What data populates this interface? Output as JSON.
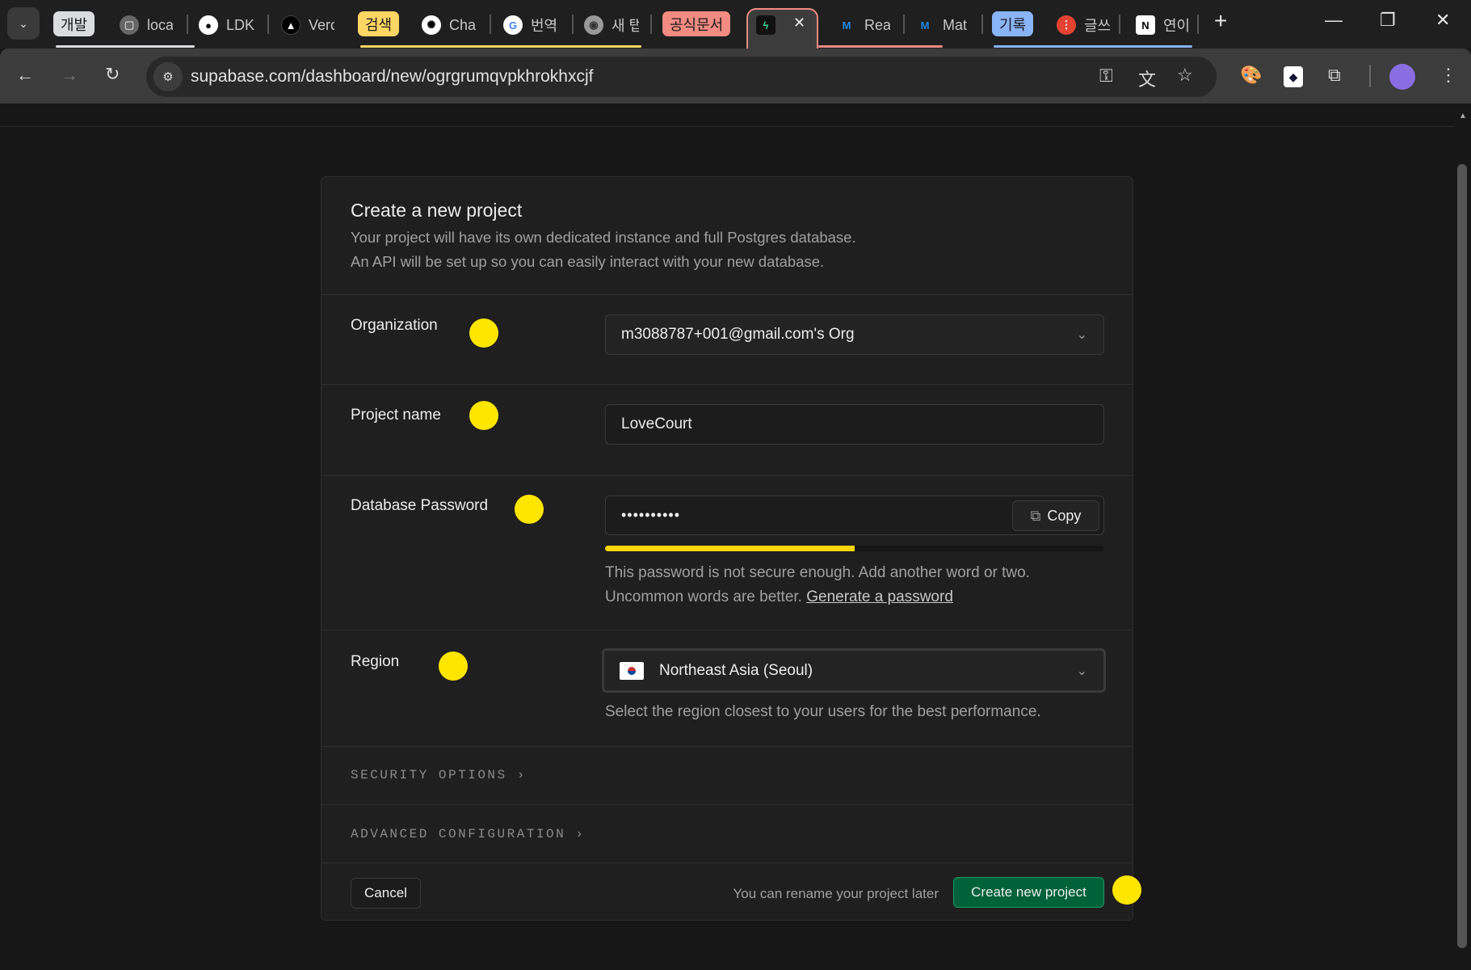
{
  "browser": {
    "tab_groups": [
      {
        "label": "개발",
        "color": "#dadce0"
      },
      {
        "label": "검색",
        "color": "#fdd663"
      },
      {
        "label": "공식문서",
        "color": "#f28b82"
      },
      {
        "label": "기록",
        "color": "#8ab4f8"
      }
    ],
    "tabs": [
      "loca",
      "LDK",
      "Verc",
      "Cha",
      "번역",
      "새 탭",
      "",
      "Rea",
      "Mat",
      "글쓰",
      "연이"
    ],
    "active_tab_close": "✕",
    "new_tab": "+",
    "url": "supabase.com/dashboard/new/ogrgrumqvpkhrokhxcjf"
  },
  "form": {
    "title": "Create a new project",
    "desc1": "Your project will have its own dedicated instance and full Postgres database.",
    "desc2": "An API will be set up so you can easily interact with your new database.",
    "org_label": "Organization",
    "org_value": "m3088787+001@gmail.com's Org",
    "name_label": "Project name",
    "name_value": "LoveCourt",
    "pw_label": "Database Password",
    "pw_value": "••••••••••",
    "copy_label": "Copy",
    "pw_strength_percent": 50,
    "pw_help1": "This password is not secure enough. Add another word or two.",
    "pw_help2": "Uncommon words are better.",
    "generate_link": "Generate a password",
    "region_label": "Region",
    "region_value": "Northeast Asia (Seoul)",
    "region_help": "Select the region closest to your users for the best performance.",
    "security": "SECURITY OPTIONS",
    "advanced": "ADVANCED CONFIGURATION",
    "cancel": "Cancel",
    "rename_note": "You can rename your project later",
    "create": "Create new project"
  },
  "colors": {
    "accent": "#006239",
    "strength": "#ffd60a",
    "marker": "#ffe600"
  }
}
